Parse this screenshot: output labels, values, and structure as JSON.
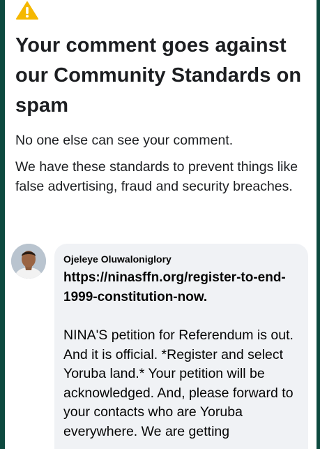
{
  "notice": {
    "icon": "warning-icon",
    "title": "Your comment goes against our Community Standards on spam",
    "subtitle": "No one else can see your comment.",
    "body": "We have these standards to prevent things like false advertising, fraud and security breaches."
  },
  "comment": {
    "author": "Ojeleye Oluwaloniglory",
    "link": "https://ninasffn.org/register-to-end-1999-constitution-now",
    "link_suffix": ".",
    "text": "NINA'S petition for Referendum is out. And it is official. *Register and select Yoruba land.* Your petition will be acknowledged. And, please forward to your contacts who are Yoruba everywhere. We are getting"
  },
  "colors": {
    "frame_border": "#0d4a3f",
    "warning": "#f5b800",
    "bubble": "#f0f2f5",
    "text": "#1c1e21"
  }
}
